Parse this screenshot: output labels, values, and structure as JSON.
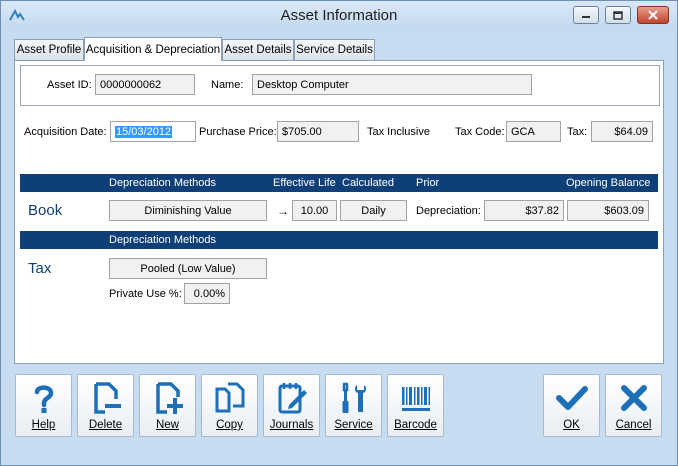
{
  "window": {
    "title": "Asset Information"
  },
  "tabs": [
    {
      "label": "Asset Profile"
    },
    {
      "label": "Acquisition & Depreciation"
    },
    {
      "label": "Asset Details"
    },
    {
      "label": "Service Details"
    }
  ],
  "asset": {
    "id_label": "Asset ID:",
    "id_value": "0000000062",
    "name_label": "Name:",
    "name_value": "Desktop Computer"
  },
  "acquisition": {
    "date_label": "Acquisition Date:",
    "date_value": "15/03/2012",
    "price_label": "Purchase Price:",
    "price_value": "$705.00",
    "tax_inclusive_label": "Tax Inclusive",
    "tax_code_label": "Tax Code:",
    "tax_code_value": "GCA",
    "tax_label": "Tax:",
    "tax_value": "$64.09"
  },
  "book": {
    "header": {
      "methods": "Depreciation Methods",
      "effective_life": "Effective Life",
      "calculated": "Calculated",
      "prior": "Prior",
      "opening_balance": "Opening Balance"
    },
    "label": "Book",
    "method_value": "Diminishing Value",
    "arrow": "→",
    "effective_life_value": "10.00",
    "calculated_value": "Daily",
    "depreciation_label": "Depreciation:",
    "prior_value": "$37.82",
    "opening_balance_value": "$603.09"
  },
  "tax": {
    "header": {
      "methods": "Depreciation Methods"
    },
    "label": "Tax",
    "method_value": "Pooled (Low Value)",
    "private_use_label": "Private Use %:",
    "private_use_value": "0.00%"
  },
  "toolbar": {
    "help": "Help",
    "delete": "Delete",
    "new": "New",
    "copy": "Copy",
    "journals": "Journals",
    "service": "Service",
    "barcode": "Barcode",
    "ok": "OK",
    "cancel": "Cancel"
  },
  "colors": {
    "accent": "#0e3f78",
    "icon_blue": "#1d6fb8",
    "window_bg": "#c7dcf0"
  }
}
